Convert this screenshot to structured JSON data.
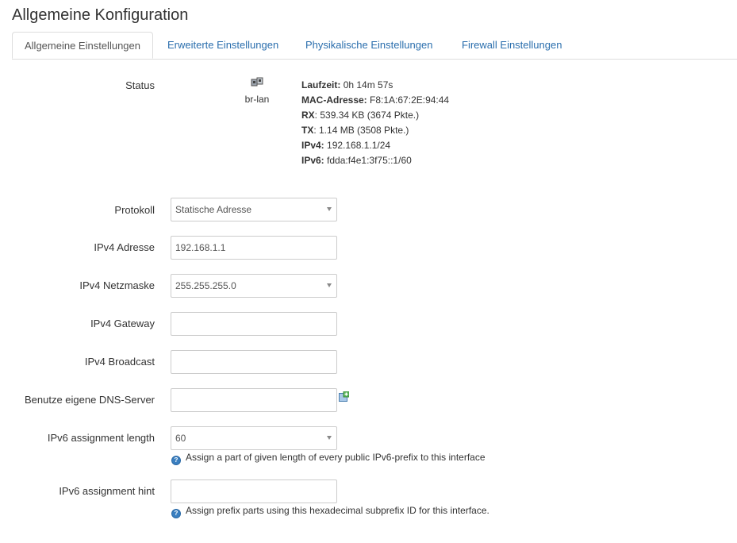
{
  "page": {
    "title": "Allgemeine Konfiguration"
  },
  "tabs": [
    {
      "label": "Allgemeine Einstellungen"
    },
    {
      "label": "Erweiterte Einstellungen"
    },
    {
      "label": "Physikalische Einstellungen"
    },
    {
      "label": "Firewall Einstellungen"
    }
  ],
  "status": {
    "label": "Status",
    "ifname": "br-lan",
    "icon": "network-bridge-icon",
    "lines": [
      {
        "key": "Laufzeit:",
        "value": "0h 14m 57s"
      },
      {
        "key": "MAC-Adresse:",
        "value": "F8:1A:67:2E:94:44"
      },
      {
        "key": "RX",
        "value": ": 539.34 KB (3674 Pkte.)"
      },
      {
        "key": "TX",
        "value": ": 1.14 MB (3508 Pkte.)"
      },
      {
        "key": "IPv4:",
        "value": "192.168.1.1/24"
      },
      {
        "key": "IPv6:",
        "value": "fdda:f4e1:3f75::1/60"
      }
    ]
  },
  "form": {
    "protokoll": {
      "label": "Protokoll",
      "value": "Statische Adresse"
    },
    "ipv4_address": {
      "label": "IPv4 Adresse",
      "value": "192.168.1.1"
    },
    "ipv4_netmask": {
      "label": "IPv4 Netzmaske",
      "value": "255.255.255.0"
    },
    "ipv4_gateway": {
      "label": "IPv4 Gateway",
      "value": ""
    },
    "ipv4_broadcast": {
      "label": "IPv4 Broadcast",
      "value": ""
    },
    "dns": {
      "label": "Benutze eigene DNS-Server",
      "value": ""
    },
    "ipv6_len": {
      "label": "IPv6 assignment length",
      "value": "60",
      "hint": "Assign a part of given length of every public IPv6-prefix to this interface"
    },
    "ipv6_hint": {
      "label": "IPv6 assignment hint",
      "value": "",
      "hint": "Assign prefix parts using this hexadecimal subprefix ID for this interface."
    }
  },
  "colors": {
    "link": "#2a6ead",
    "help_icon": "#3a7fc0",
    "add_icon": "#4caf50"
  }
}
